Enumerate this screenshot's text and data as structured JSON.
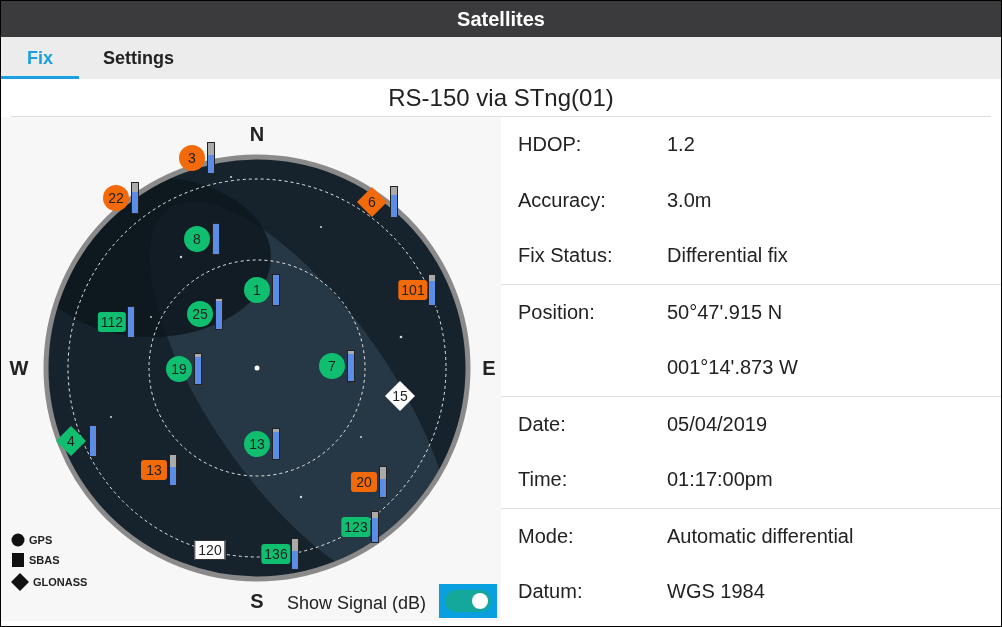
{
  "window": {
    "title": "Satellites"
  },
  "tabs": [
    {
      "label": "Fix",
      "selected": true
    },
    {
      "label": "Settings",
      "selected": false
    }
  ],
  "receiver": "RS-150 via STng(01)",
  "sky_plot": {
    "compass": {
      "north": "N",
      "west": "W",
      "east": "E",
      "south": "S"
    },
    "satellites": [
      {
        "id": "3",
        "kind": "gps",
        "color": "#f26a0a",
        "level": 0.6
      },
      {
        "id": "22",
        "kind": "gps",
        "color": "#f26a0a",
        "level": 0.7
      },
      {
        "id": "6",
        "kind": "glonass",
        "color": "#f26a0a",
        "level": 0.75
      },
      {
        "id": "8",
        "kind": "gps",
        "color": "#0fbf6f",
        "level": 1
      },
      {
        "id": "1",
        "kind": "gps",
        "color": "#0fbf6f",
        "level": 1
      },
      {
        "id": "101",
        "kind": "sbas",
        "color": "#f26a0a",
        "level": 0.8
      },
      {
        "id": "112",
        "kind": "sbas",
        "color": "#0fbf6f",
        "level": 1
      },
      {
        "id": "25",
        "kind": "gps",
        "color": "#0fbf6f",
        "level": 0.95
      },
      {
        "id": "19",
        "kind": "gps",
        "color": "#0fbf6f",
        "level": 0.9
      },
      {
        "id": "7",
        "kind": "gps",
        "color": "#0fbf6f",
        "level": 0.9
      },
      {
        "id": "15",
        "kind": "glonass",
        "color": "#ffffff"
      },
      {
        "id": "4",
        "kind": "glonass",
        "color": "#0fbf6f",
        "level": 1
      },
      {
        "id": "13",
        "kind": "gps",
        "color": "#0fbf6f",
        "level": 0.9
      },
      {
        "id": "13",
        "kind": "sbas",
        "color": "#f26a0a",
        "level": 0.6
      },
      {
        "id": "20",
        "kind": "sbas",
        "color": "#f26a0a",
        "level": 0.6
      },
      {
        "id": "123",
        "kind": "sbas",
        "color": "#0fbf6f",
        "level": 0.8
      },
      {
        "id": "136",
        "kind": "sbas",
        "color": "#0fbf6f",
        "level": 0.6
      },
      {
        "id": "120",
        "kind": "sbas",
        "color": "#ffffff"
      }
    ],
    "legend": [
      {
        "kind": "gps",
        "label": "GPS"
      },
      {
        "kind": "sbas",
        "label": "SBAS"
      },
      {
        "kind": "glonass",
        "label": "GLONASS"
      }
    ],
    "show_signal": {
      "label": "Show Signal (dB)",
      "on": true
    }
  },
  "info_groups": [
    {
      "rows": [
        {
          "label": "HDOP:",
          "value": "1.2"
        },
        {
          "label": "Accuracy:",
          "value": "3.0m"
        },
        {
          "label": "Fix Status:",
          "value": "Differential fix"
        }
      ]
    },
    {
      "rows": [
        {
          "label": "Position:",
          "value": "50°47'.915 N"
        },
        {
          "value": "001°14'.873 W"
        }
      ]
    },
    {
      "rows": [
        {
          "label": "Date:",
          "value": "05/04/2019"
        },
        {
          "label": "Time:",
          "value": "01:17:00pm"
        }
      ]
    },
    {
      "rows": [
        {
          "label": "Mode:",
          "value": "Automatic differential"
        },
        {
          "label": "Datum:",
          "value": "WGS 1984"
        }
      ]
    }
  ]
}
